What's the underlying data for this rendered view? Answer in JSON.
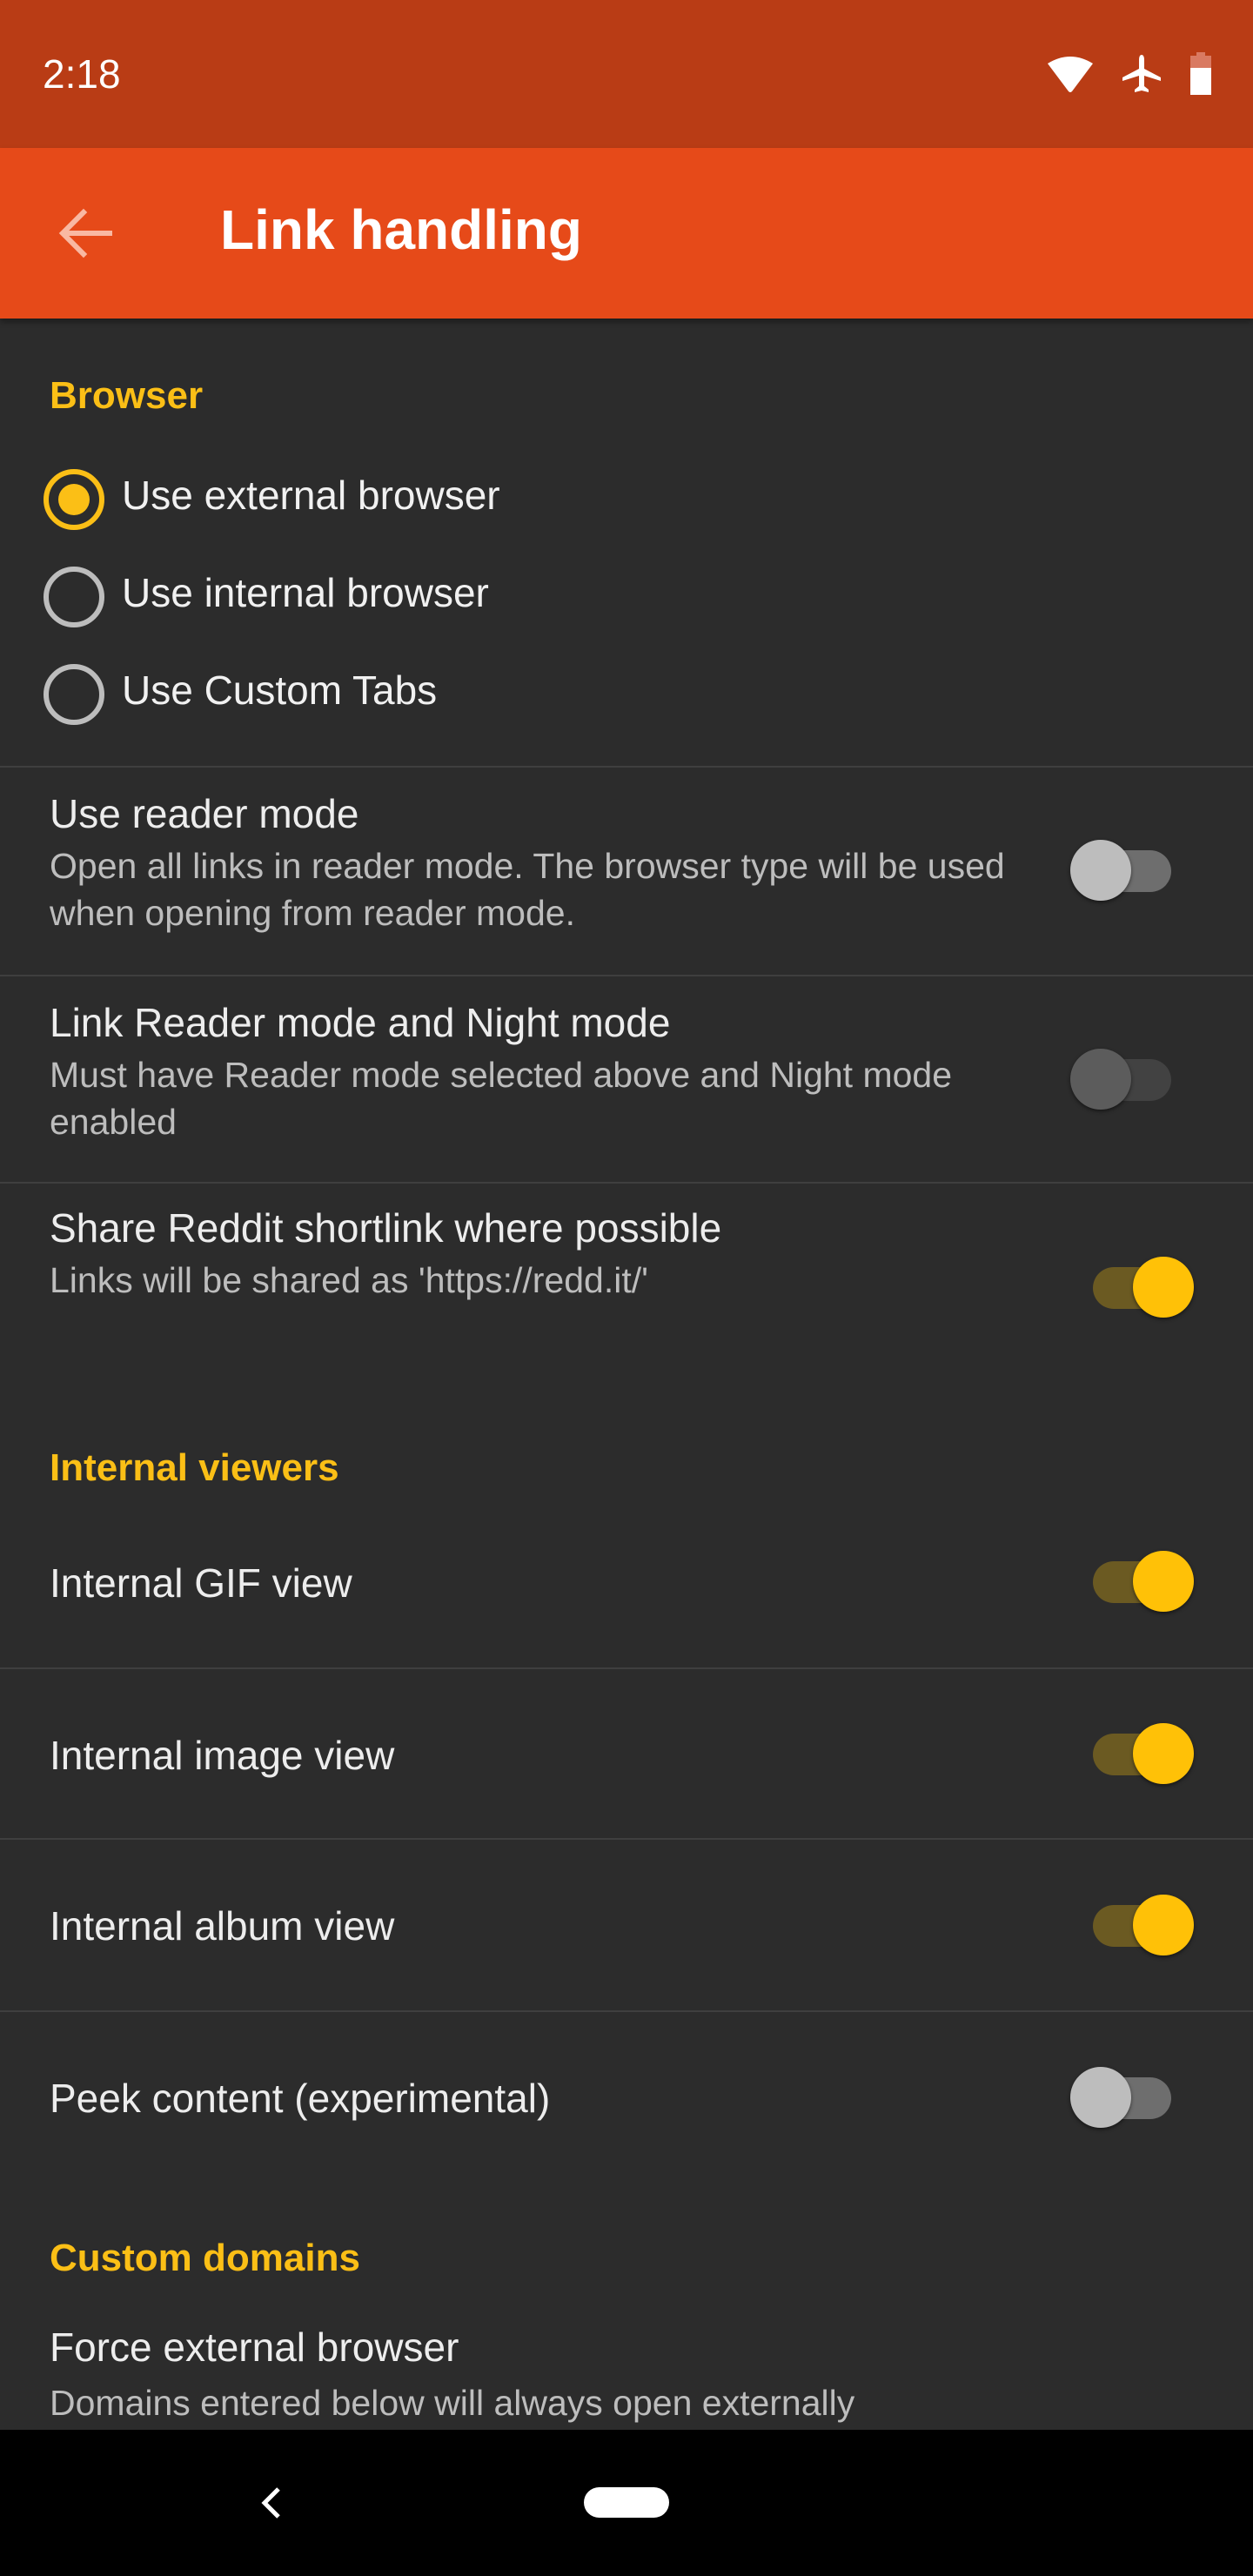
{
  "status_bar": {
    "time": "2:18",
    "icons": [
      "wifi-icon",
      "airplane-mode-icon",
      "battery-icon"
    ]
  },
  "toolbar": {
    "back_icon": "arrow-left-icon",
    "title": "Link handling"
  },
  "colors": {
    "status_bar": "#b93c15",
    "toolbar": "#e64a19",
    "accent": "#fbbf16",
    "background": "#2c2c2c"
  },
  "sections": {
    "browser": {
      "header": "Browser",
      "options": [
        {
          "label": "Use external browser",
          "selected": true
        },
        {
          "label": "Use internal browser",
          "selected": false
        },
        {
          "label": "Use Custom Tabs",
          "selected": false
        }
      ],
      "prefs": [
        {
          "title": "Use reader mode",
          "summary": "Open all links in reader mode. The browser type will be used when opening from reader mode.",
          "checked": false,
          "enabled": true
        },
        {
          "title": "Link Reader mode and Night mode",
          "summary": "Must have Reader mode selected above and Night mode enabled",
          "checked": false,
          "enabled": false
        },
        {
          "title": "Share Reddit shortlink where possible",
          "summary": "Links will be shared as 'https://redd.it/'",
          "checked": true,
          "enabled": true
        }
      ]
    },
    "internal_viewers": {
      "header": "Internal viewers",
      "prefs": [
        {
          "title": "Internal GIF view",
          "checked": true
        },
        {
          "title": "Internal image view",
          "checked": true
        },
        {
          "title": "Internal album view",
          "checked": true
        },
        {
          "title": "Peek content (experimental)",
          "checked": false
        }
      ]
    },
    "custom_domains": {
      "header": "Custom domains",
      "prefs": [
        {
          "title": "Force external browser",
          "summary": "Domains entered below will always open externally"
        }
      ]
    }
  },
  "nav_bar": {
    "back_icon": "nav-back-icon",
    "home_icon": "nav-home-pill-icon"
  }
}
